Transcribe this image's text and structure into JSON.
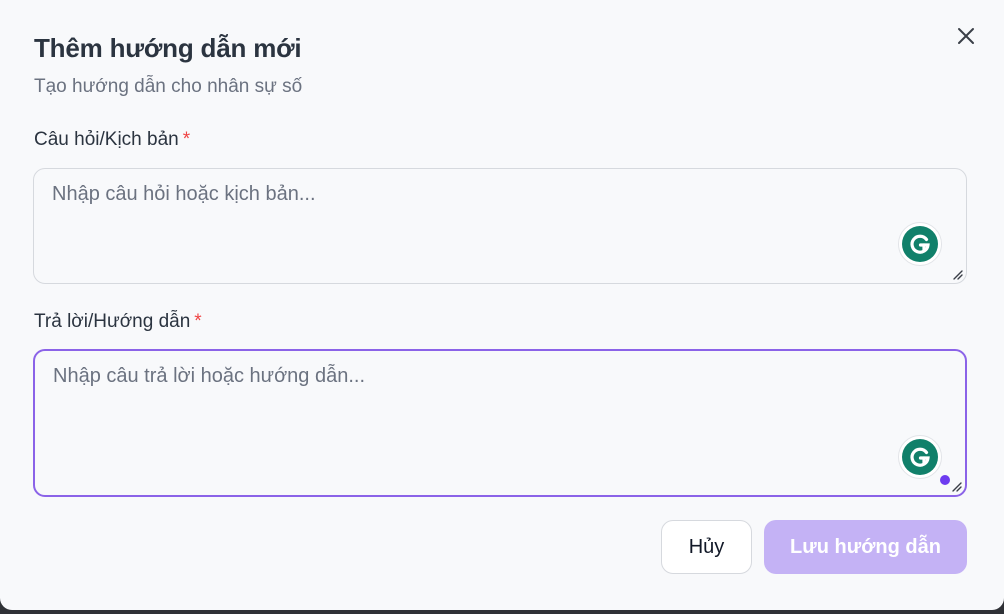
{
  "dialog": {
    "title": "Thêm hướng dẫn mới",
    "subtitle": "Tạo hướng dẫn cho nhân sự số",
    "close_icon": "close-icon"
  },
  "fields": {
    "question": {
      "label": "Câu hỏi/Kịch bản",
      "required_mark": "*",
      "placeholder": "Nhập câu hỏi hoặc kịch bản...",
      "value": ""
    },
    "answer": {
      "label": "Trả lời/Hướng dẫn",
      "required_mark": "*",
      "placeholder": "Nhập câu trả lời hoặc hướng dẫn...",
      "value": ""
    }
  },
  "buttons": {
    "cancel": "Hủy",
    "save": "Lưu hướng dẫn"
  },
  "colors": {
    "accent": "#8b63e8",
    "save_button_bg": "#c4b2f5",
    "required": "#ef4444",
    "grammarly": "#11806a"
  }
}
